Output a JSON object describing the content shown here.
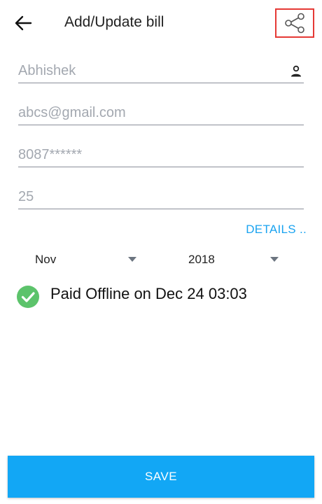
{
  "header": {
    "title": "Add/Update bill",
    "back_icon": "arrow-left-icon",
    "share_icon": "share-icon"
  },
  "form": {
    "name": {
      "value": "Abhishek",
      "icon": "person-icon"
    },
    "email": {
      "value": "abcs@gmail.com"
    },
    "phone": {
      "value": "8087******"
    },
    "amount": {
      "value": "25"
    }
  },
  "details_link": "DETAILS ..",
  "period": {
    "month": "Nov",
    "year": "2018"
  },
  "status": {
    "text": "Paid Offline on Dec 24 03:03",
    "icon": "check-circle-icon",
    "color": "#5cc36b"
  },
  "actions": {
    "save_label": "SAVE"
  },
  "colors": {
    "accent": "#12a7f5",
    "link": "#1aa3f0",
    "highlight_border": "#e53935"
  }
}
